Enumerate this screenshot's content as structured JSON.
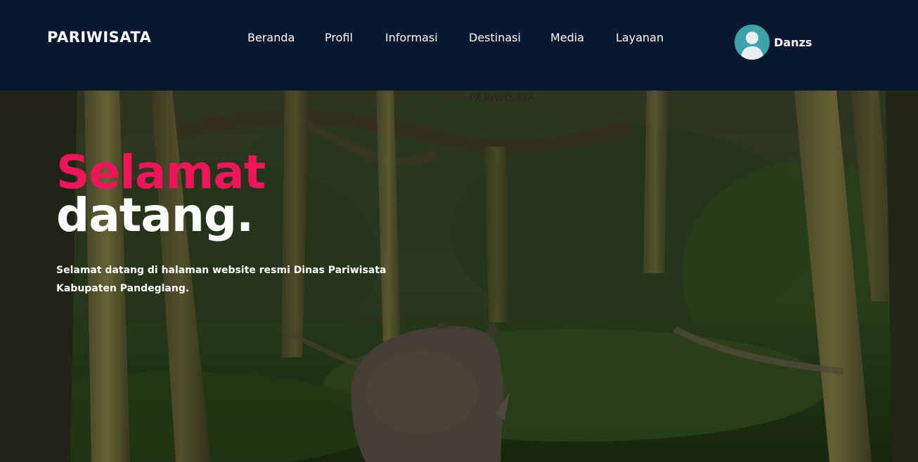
{
  "nav": {
    "brand": "PARIWISATA",
    "links": [
      {
        "label": "Beranda"
      },
      {
        "label": "Profil"
      },
      {
        "label": "Informasi"
      },
      {
        "label": "Destinasi"
      },
      {
        "label": "Media"
      },
      {
        "label": "Layanan"
      }
    ],
    "user": {
      "name": "Danzs",
      "avatar_icon": "user-avatar-icon"
    }
  },
  "hero": {
    "watermark": "PARIWISATA",
    "title_line1": "Selamat",
    "title_line2": "datang.",
    "description": "Selamat datang di halaman website resmi Dinas Pariwisata Kabupaten Pandeglang.",
    "background_image": "forest-rhino-photo"
  },
  "colors": {
    "navbar_bg": "#071830",
    "accent": "#f0145a",
    "avatar_bg": "#3ba3a9",
    "text": "#ffffff"
  }
}
